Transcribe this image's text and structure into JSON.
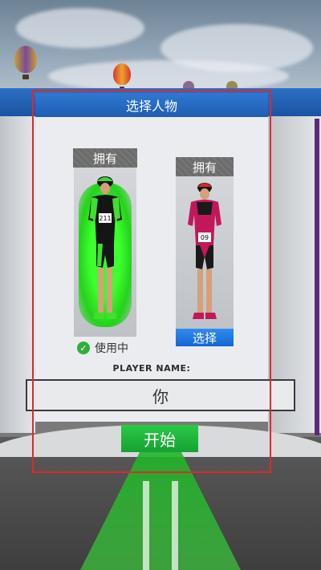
{
  "title": "选择人物",
  "characters": [
    {
      "owned_label": "拥有",
      "number": "211",
      "status": "使用中",
      "selected": true,
      "color": "#39e52a"
    },
    {
      "owned_label": "拥有",
      "number": "09",
      "select_label": "选择",
      "selected": false,
      "color": "#c2185b"
    }
  ],
  "player_name_label": "PLAYER NAME:",
  "player_name_value": "你",
  "start_label": "开始",
  "icons": {
    "check": "check-icon"
  },
  "colors": {
    "header_blue": "#2f78d0",
    "start_green": "#2bc946",
    "select_blue": "#2f8cf0",
    "highlight_red": "#e0282b"
  }
}
